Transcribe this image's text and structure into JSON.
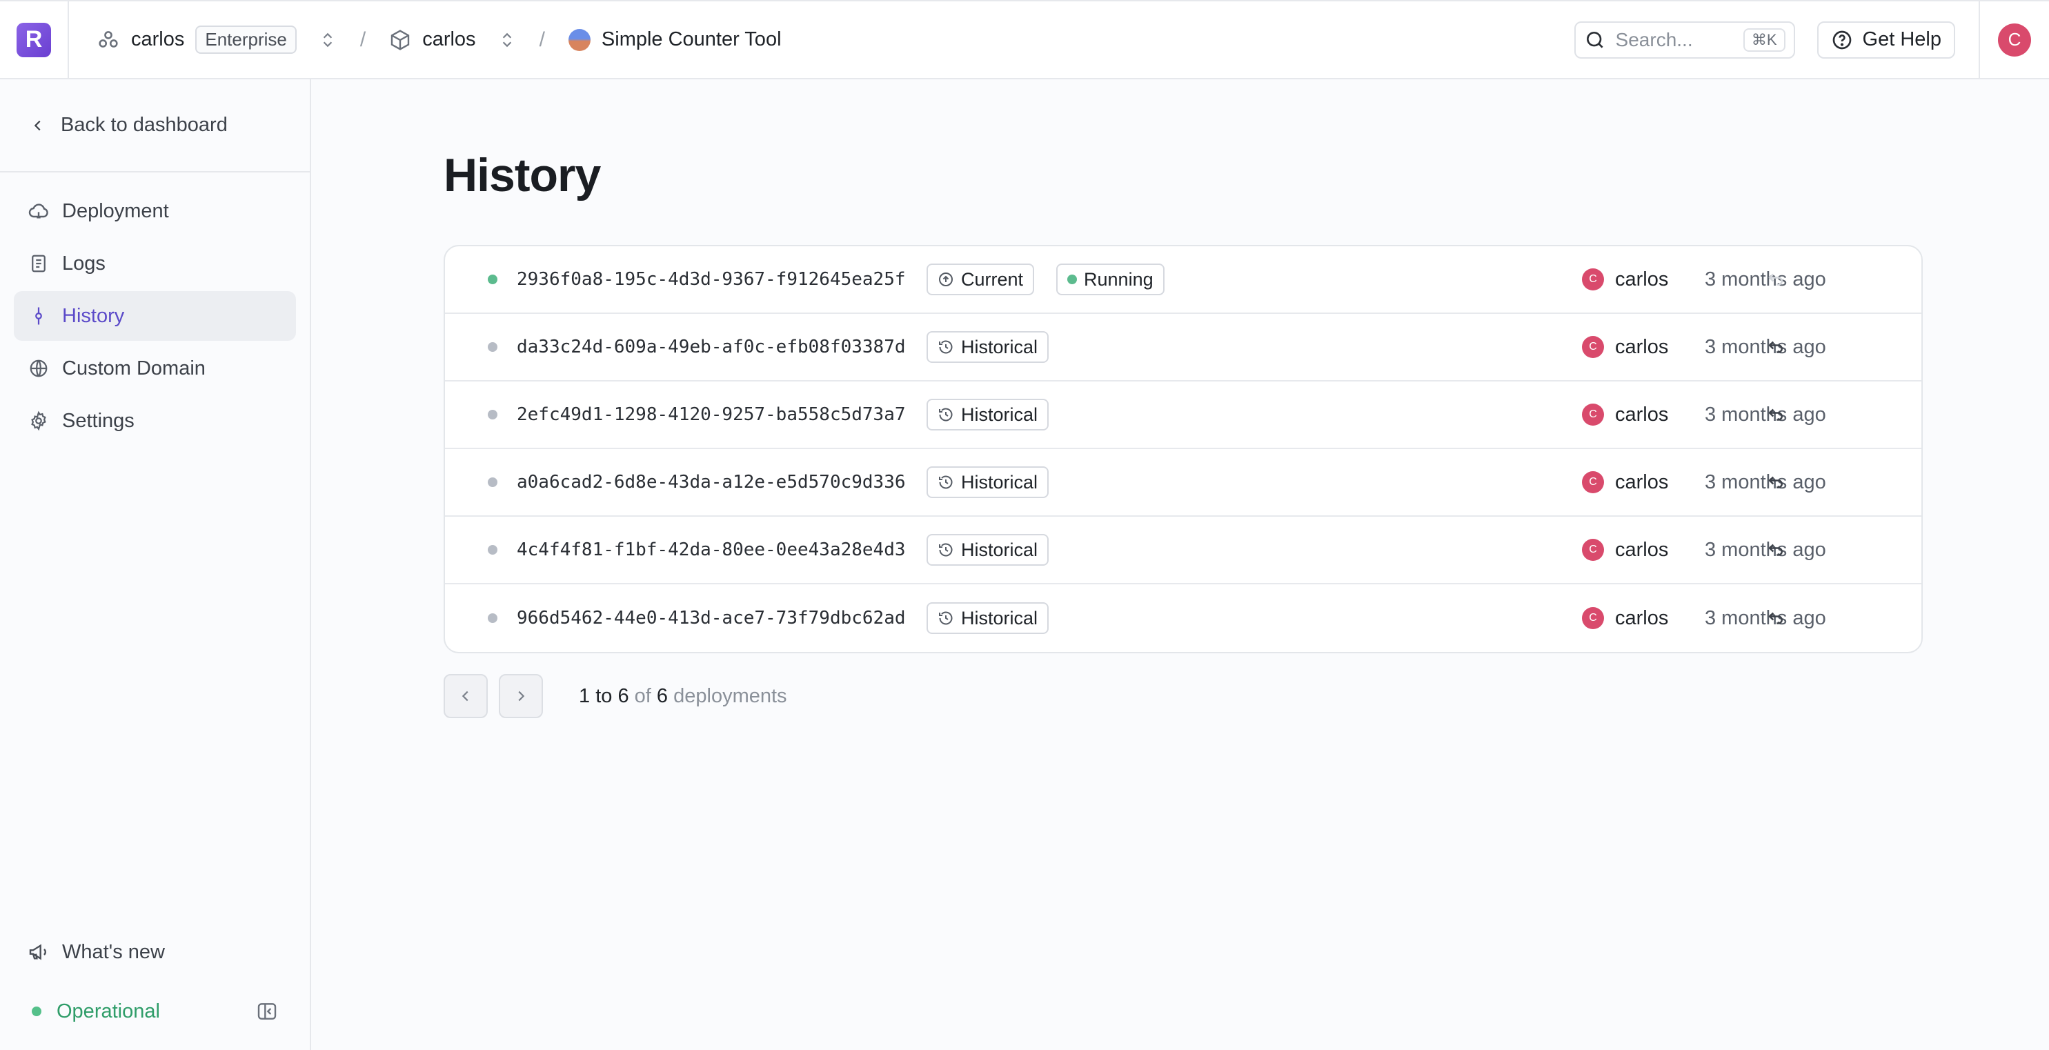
{
  "header": {
    "logo_letter": "R",
    "org": {
      "name": "carlos",
      "plan": "Enterprise"
    },
    "project": {
      "name": "carlos"
    },
    "app": {
      "name": "Simple Counter Tool"
    },
    "search": {
      "placeholder": "Search...",
      "shortcut": "⌘K"
    },
    "help_label": "Get Help",
    "avatar_letter": "C"
  },
  "sidebar": {
    "back_label": "Back to dashboard",
    "items": [
      {
        "label": "Deployment",
        "icon": "cloud-icon"
      },
      {
        "label": "Logs",
        "icon": "file-text-icon"
      },
      {
        "label": "History",
        "icon": "git-commit-icon",
        "active": true
      },
      {
        "label": "Custom Domain",
        "icon": "globe-icon"
      },
      {
        "label": "Settings",
        "icon": "gear-icon"
      }
    ],
    "whats_new": "What's new",
    "status": "Operational"
  },
  "main": {
    "title": "History",
    "deployments": [
      {
        "id": "2936f0a8-195c-4d3d-9367-f912645ea25f",
        "badge": "Current",
        "state": "Running",
        "user": "carlos",
        "user_initial": "C",
        "time": "3 months ago"
      },
      {
        "id": "da33c24d-609a-49eb-af0c-efb08f03387d",
        "badge": "Historical",
        "user": "carlos",
        "user_initial": "C",
        "time": "3 months ago"
      },
      {
        "id": "2efc49d1-1298-4120-9257-ba558c5d73a7",
        "badge": "Historical",
        "user": "carlos",
        "user_initial": "C",
        "time": "3 months ago"
      },
      {
        "id": "a0a6cad2-6d8e-43da-a12e-e5d570c9d336",
        "badge": "Historical",
        "user": "carlos",
        "user_initial": "C",
        "time": "3 months ago"
      },
      {
        "id": "4c4f4f81-f1bf-42da-80ee-0ee43a28e4d3",
        "badge": "Historical",
        "user": "carlos",
        "user_initial": "C",
        "time": "3 months ago"
      },
      {
        "id": "966d5462-44e0-413d-ace7-73f79dbc62ad",
        "badge": "Historical",
        "user": "carlos",
        "user_initial": "C",
        "time": "3 months ago"
      }
    ],
    "pagination": {
      "from": "1",
      "to_word": "to",
      "to": "6",
      "of_word": "of",
      "total": "6",
      "unit": "deployments"
    }
  },
  "colors": {
    "accent": "#5b4ac9",
    "status_green": "#2f9d69",
    "avatar": "#d94a6c"
  }
}
